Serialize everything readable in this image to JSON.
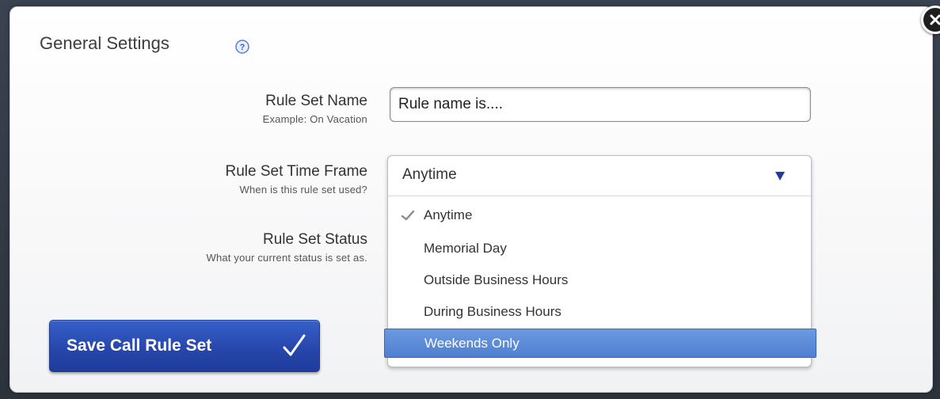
{
  "dialog": {
    "title": "General Settings",
    "help_icon": "help-icon",
    "close_icon": "close-icon"
  },
  "fields": {
    "name": {
      "label": "Rule Set Name",
      "hint": "Example: On Vacation",
      "value": "Rule name is...."
    },
    "time_frame": {
      "label": "Rule Set Time Frame",
      "hint": "When is this rule set used?",
      "selected": "Anytime",
      "options": [
        {
          "label": "Anytime",
          "checked": true,
          "highlighted": false
        },
        {
          "label": "Memorial Day",
          "checked": false,
          "highlighted": false
        },
        {
          "label": "Outside Business Hours",
          "checked": false,
          "highlighted": false
        },
        {
          "label": "During Business Hours",
          "checked": false,
          "highlighted": false
        },
        {
          "label": "Weekends Only",
          "checked": false,
          "highlighted": true
        }
      ]
    },
    "status": {
      "label": "Rule Set Status",
      "hint": "What your current status is set as."
    }
  },
  "save_button": {
    "label": "Save Call Rule Set",
    "icon": "checkmark-icon"
  },
  "colors": {
    "button_blue": "#2747ad",
    "highlight_blue": "#5b8ad8",
    "arrow_blue": "#1f3c9c",
    "help_blue": "#5a7fd6"
  }
}
